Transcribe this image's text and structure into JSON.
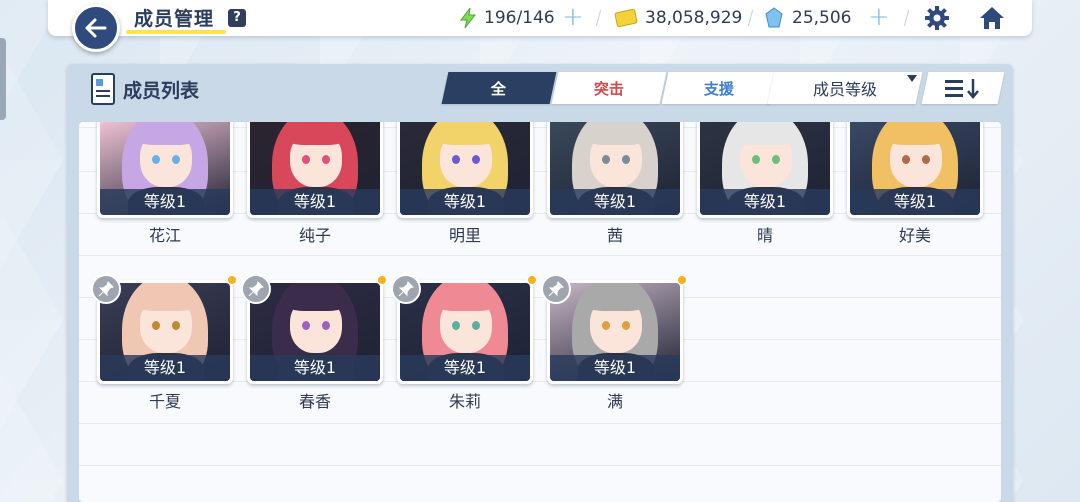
{
  "header": {
    "title": "成员管理",
    "help": "?",
    "stamina": "196/146",
    "credits": "38,058,929",
    "gems": "25,506",
    "plus": "+"
  },
  "panel": {
    "title": "成员列表",
    "tabs": [
      {
        "label": "全",
        "active": true
      },
      {
        "label": "突击",
        "active": false
      },
      {
        "label": "支援",
        "active": false
      }
    ],
    "sort_label": "成员等级"
  },
  "members_row1": [
    {
      "name": "花江",
      "level": "等级1",
      "hair": "#c7a6e6",
      "bg": "#f5c7d9",
      "eye": "#6ab0e6"
    },
    {
      "name": "纯子",
      "level": "等级1",
      "hair": "#d9475a",
      "bg": "#2c2430",
      "eye": "#e0507a"
    },
    {
      "name": "明里",
      "level": "等级1",
      "hair": "#f2d36a",
      "bg": "#2a2a38",
      "eye": "#6a5ad0"
    },
    {
      "name": "茜",
      "level": "等级1",
      "hair": "#d8d2cc",
      "bg": "#3a4a5c",
      "eye": "#7a8a99"
    },
    {
      "name": "晴",
      "level": "等级1",
      "hair": "#e6e6e6",
      "bg": "#2c3444",
      "eye": "#6ac07a"
    },
    {
      "name": "好美",
      "level": "等级1",
      "hair": "#f2c064",
      "bg": "#3a4a66",
      "eye": "#b06a4a"
    }
  ],
  "members_row2": [
    {
      "name": "千夏",
      "level": "等级1",
      "hair": "#f0c7b2",
      "bg": "#3b3d55",
      "eye": "#c08a30"
    },
    {
      "name": "春香",
      "level": "等级1",
      "hair": "#3a2c4a",
      "bg": "#2d2b44",
      "eye": "#a060c0"
    },
    {
      "name": "朱莉",
      "level": "等级1",
      "hair": "#ef8a95",
      "bg": "#2a3048",
      "eye": "#5ab0a0"
    },
    {
      "name": "满",
      "level": "等级1",
      "hair": "#a9a9a9",
      "bg": "#c8b6c6",
      "eye": "#e0a040"
    }
  ]
}
